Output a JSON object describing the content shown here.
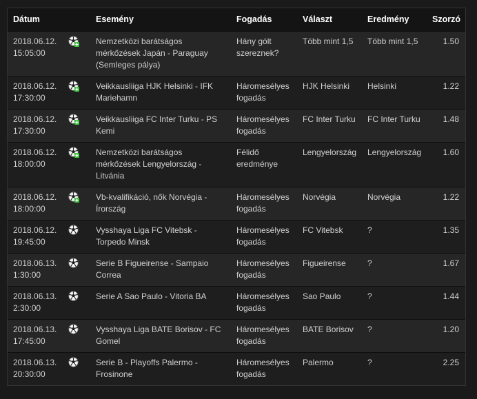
{
  "columns": {
    "date": "Dátum",
    "event": "Esemény",
    "bet": "Fogadás",
    "choice": "Választ",
    "result": "Eredmény",
    "odds": "Szorzó"
  },
  "rows": [
    {
      "date": "2018.06.12.",
      "time": "15:05:00",
      "icon": "soccer-ball-plus-icon",
      "event": "Nemzetközi barátságos mérkőzések Japán - Paraguay (Semleges pálya)",
      "bet": "Hány gólt szereznek?",
      "choice": "Több mint 1,5",
      "result": "Több mint 1,5",
      "odds": "1.50"
    },
    {
      "date": "2018.06.12.",
      "time": "17:30:00",
      "icon": "soccer-ball-plus-icon",
      "event": "Veikkausliiga HJK Helsinki - IFK Mariehamn",
      "bet": "Háromesélyes fogadás",
      "choice": "HJK Helsinki",
      "result": "Helsinki",
      "odds": "1.22"
    },
    {
      "date": "2018.06.12.",
      "time": "17:30:00",
      "icon": "soccer-ball-plus-icon",
      "event": "Veikkausliiga FC Inter Turku - PS Kemi",
      "bet": "Háromesélyes fogadás",
      "choice": "FC Inter Turku",
      "result": "FC Inter Turku",
      "odds": "1.48"
    },
    {
      "date": "2018.06.12.",
      "time": "18:00:00",
      "icon": "soccer-ball-plus-icon",
      "event": "Nemzetközi barátságos mérkőzések Lengyelország - Litvánia",
      "bet": "Félidő eredménye",
      "choice": "Lengyelország",
      "result": "Lengyelország",
      "odds": "1.60"
    },
    {
      "date": "2018.06.12.",
      "time": "18:00:00",
      "icon": "soccer-ball-plus-icon",
      "event": "Vb-kvalifikáció, nők Norvégia - Írország",
      "bet": "Háromesélyes fogadás",
      "choice": "Norvégia",
      "result": "Norvégia",
      "odds": "1.22"
    },
    {
      "date": "2018.06.12.",
      "time": "19:45:00",
      "icon": "soccer-ball-icon",
      "event": "Vysshaya Liga FC Vitebsk - Torpedo Minsk",
      "bet": "Háromesélyes fogadás",
      "choice": "FC Vitebsk",
      "result": "?",
      "odds": "1.35"
    },
    {
      "date": "2018.06.13.",
      "time": "1:30:00",
      "icon": "soccer-ball-icon",
      "event": "Serie B Figueirense - Sampaio Correa",
      "bet": "Háromesélyes fogadás",
      "choice": "Figueirense",
      "result": "?",
      "odds": "1.67"
    },
    {
      "date": "2018.06.13.",
      "time": "2:30:00",
      "icon": "soccer-ball-icon",
      "event": "Serie A Sao Paulo - Vitoria BA",
      "bet": "Háromesélyes fogadás",
      "choice": "Sao Paulo",
      "result": "?",
      "odds": "1.44"
    },
    {
      "date": "2018.06.13.",
      "time": "17:45:00",
      "icon": "soccer-ball-icon",
      "event": "Vysshaya Liga BATE Borisov - FC Gomel",
      "bet": "Háromesélyes fogadás",
      "choice": "BATE Borisov",
      "result": "?",
      "odds": "1.20"
    },
    {
      "date": "2018.06.13.",
      "time": "20:30:00",
      "icon": "soccer-ball-icon",
      "event": "Serie B - Playoffs Palermo - Frosinone",
      "bet": "Háromesélyes fogadás",
      "choice": "Palermo",
      "result": "?",
      "odds": "2.25"
    }
  ],
  "colors": {
    "header_bg": "#141414",
    "row_odd": "#262626",
    "row_even": "#1e1e1e",
    "win_badge": "#3cc43c"
  }
}
